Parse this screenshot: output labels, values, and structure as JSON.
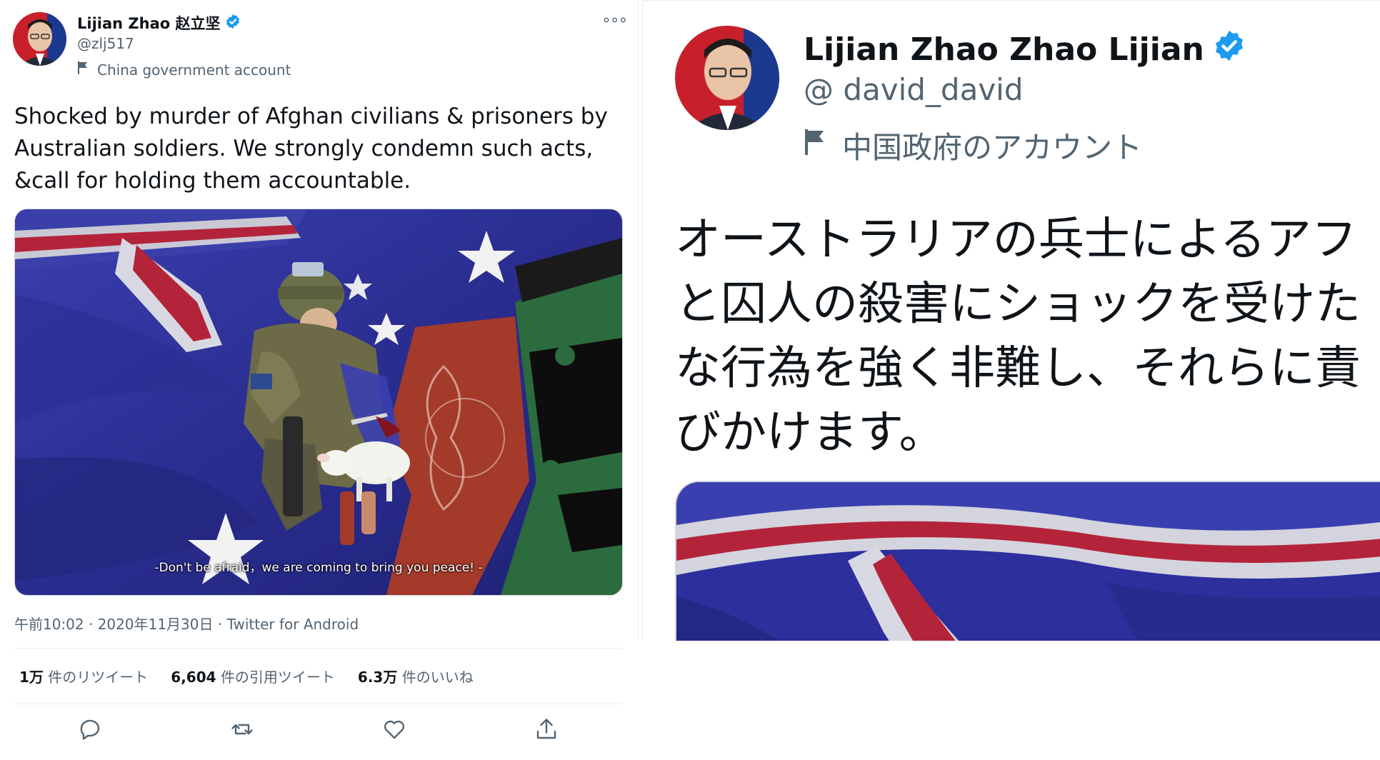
{
  "left_tweet": {
    "author": {
      "display_name": "Lijian Zhao 赵立坚",
      "handle": "@zlj517",
      "label": "China government account"
    },
    "more_menu": "∘∘∘",
    "text_lines": [
      "Shocked by murder of Afghan civilians & prisoners by",
      "Australian soldiers. We strongly condemn such acts,",
      "&call for holding them accountable."
    ],
    "media": {
      "caption": "-Don't be afraid，we are coming to bring you peace! -"
    },
    "meta": "午前10:02 · 2020年11月30日 · Twitter for Android",
    "stats": [
      {
        "value": "1万",
        "label": "件のリツイート"
      },
      {
        "value": "6,604",
        "label": "件の引用ツイート"
      },
      {
        "value": "6.3万",
        "label": "件のいいね"
      }
    ],
    "actions": [
      "reply-icon",
      "retweet-icon",
      "like-icon",
      "share-icon"
    ]
  },
  "right_tweet": {
    "author": {
      "display_name": "Lijian Zhao Zhao Lijian",
      "handle": "@ david_david",
      "label": "中国政府のアカウント"
    },
    "text_lines": [
      "オーストラリアの兵士によるアフ",
      "と囚人の殺害にショックを受けた",
      "な行為を強く非難し、それらに責",
      "びかけます。"
    ]
  },
  "colors": {
    "verified": "#1d9bf0",
    "secondary_text": "#536471",
    "primary_text": "#0f1419",
    "flag_blue": "#2c2f9c",
    "flag_red": "#b3243b",
    "afghan_red": "#a43a2a",
    "afghan_green": "#2b6b3d",
    "puzzle_black": "#0d0d0d"
  }
}
